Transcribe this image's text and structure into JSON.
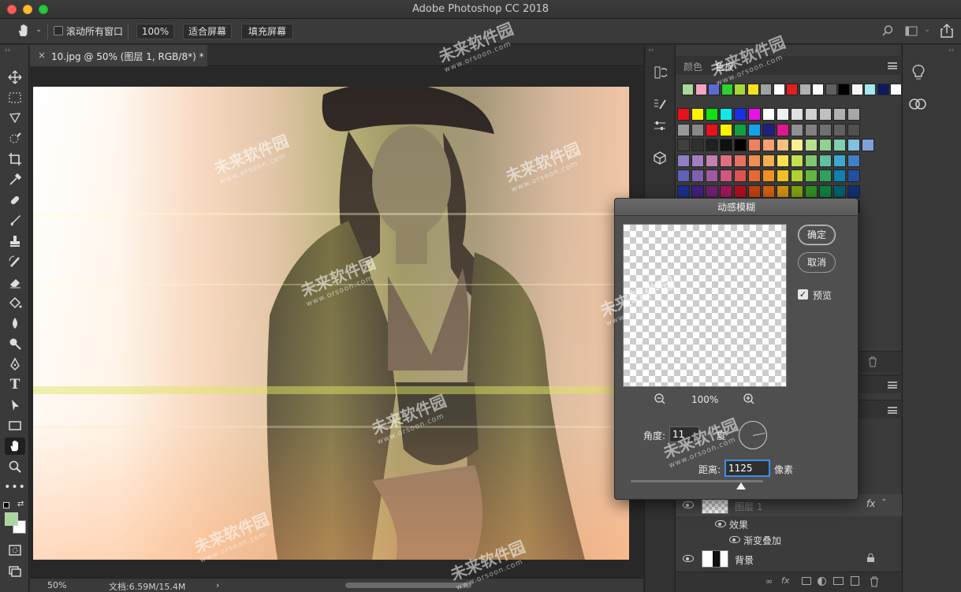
{
  "window": {
    "title": "Adobe Photoshop CC 2018"
  },
  "options_bar": {
    "scroll_all_label": "滚动所有窗口",
    "zoom_100_label": "100%",
    "fit_screen_label": "适合屏幕",
    "fill_screen_label": "填充屏幕"
  },
  "document": {
    "tab_title": "10.jpg @ 50% (图层 1, RGB/8*) *",
    "close_label": "×"
  },
  "status": {
    "zoom": "50%",
    "doc_size": "文档:6.59M/15.4M",
    "arrow": "›"
  },
  "panels": {
    "tab_color": "颜色",
    "tab_swatches": "色板",
    "recent_swatches": [
      "#a8d89a",
      "#f4a3c0",
      "#5b6bd6",
      "#2fd12f",
      "#a6d83a",
      "#f7e11a",
      "#9fa3a6",
      "#ffffff",
      "#e02020",
      "#b0b0b0",
      "#ffffff",
      "#606060",
      "#000000",
      "#f5f5f5",
      "#a6e7ee",
      "#0e1a5e",
      "#ffffff"
    ],
    "swatch_rows": [
      [
        "#e8121a",
        "#fff200",
        "#12e012",
        "#12e8e8",
        "#1a30e8",
        "#e812e8",
        "#ffffff",
        "#f0f0f0",
        "#e0e0e0",
        "#d0d0d0",
        "#c0c0c0",
        "#b0b0b0",
        "#a8a8a8"
      ],
      [
        "#989898",
        "#888888",
        "#e8121a",
        "#fff200",
        "#12a040",
        "#1aa0e8",
        "#202080",
        "#e01890",
        "#909090",
        "#808080",
        "#707070",
        "#606060",
        "#505050"
      ],
      [
        "#404040",
        "#303030",
        "#202020",
        "#101010",
        "#000000",
        "#f08060",
        "#f8a070",
        "#f8c080",
        "#f8f090",
        "#b8e090",
        "#90d090",
        "#80d0b0",
        "#80c0e0",
        "#80a0d8"
      ],
      [
        "#9080c8",
        "#a080c0",
        "#c080b0",
        "#e07080",
        "#e87060",
        "#f09050",
        "#f0b050",
        "#f8e050",
        "#c0e050",
        "#80c870",
        "#60c0a0",
        "#40a8d0",
        "#4080c8"
      ],
      [
        "#6060b8",
        "#8060b0",
        "#a058a0",
        "#d05880",
        "#e05050",
        "#e86830",
        "#f09020",
        "#f0c020",
        "#b0d030",
        "#60b840",
        "#30a060",
        "#1080b0",
        "#2050a0"
      ],
      [
        "#1a3090",
        "#402080",
        "#702070",
        "#a01858",
        "#b01020",
        "#c04010",
        "#d06010",
        "#d09010",
        "#80a010",
        "#309020",
        "#108040",
        "#006070",
        "#103070"
      ],
      [
        "#0a1860",
        "#201050",
        "#401040",
        "#700030",
        "#800000",
        "#804000",
        "#805000",
        "#806000",
        "#506000",
        "#205010",
        "#004020",
        "#003040",
        "#101848"
      ]
    ],
    "layers": [
      {
        "name": "图层 1",
        "fx": "fx"
      },
      {
        "name": "效果"
      },
      {
        "name": "渐变叠加"
      },
      {
        "name": "背景"
      }
    ]
  },
  "dialog": {
    "title": "动感模糊",
    "ok_label": "确定",
    "cancel_label": "取消",
    "preview_label": "预览",
    "preview_zoom": "100%",
    "angle_label": "角度:",
    "angle_value": "11",
    "angle_unit": "度",
    "distance_label": "距离:",
    "distance_value": "1125",
    "distance_unit": "像素",
    "checkmark": "✓"
  },
  "watermark": {
    "text": "未来软件园",
    "url": "www.orsoon.com"
  }
}
